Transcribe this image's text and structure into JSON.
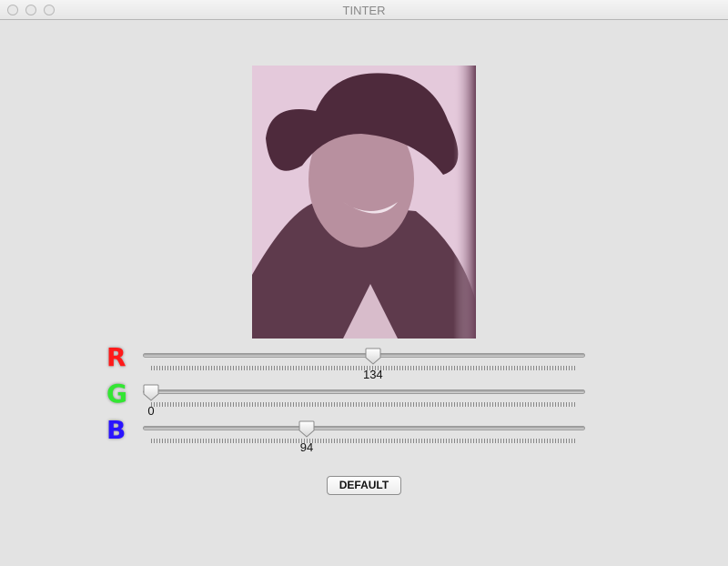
{
  "window": {
    "title": "TINTER"
  },
  "tint_color": "#e4c9db",
  "shadow_color": "#4e2a3c",
  "sliders": [
    {
      "label": "R",
      "color": "#ff1a1a",
      "value": 134,
      "value_text": "134",
      "max": 255
    },
    {
      "label": "G",
      "color": "#33e633",
      "value": 0,
      "value_text": "0",
      "max": 255
    },
    {
      "label": "B",
      "color": "#2a14ff",
      "value": 94,
      "value_text": "94",
      "max": 255
    }
  ],
  "default_button": "DEFAULT"
}
